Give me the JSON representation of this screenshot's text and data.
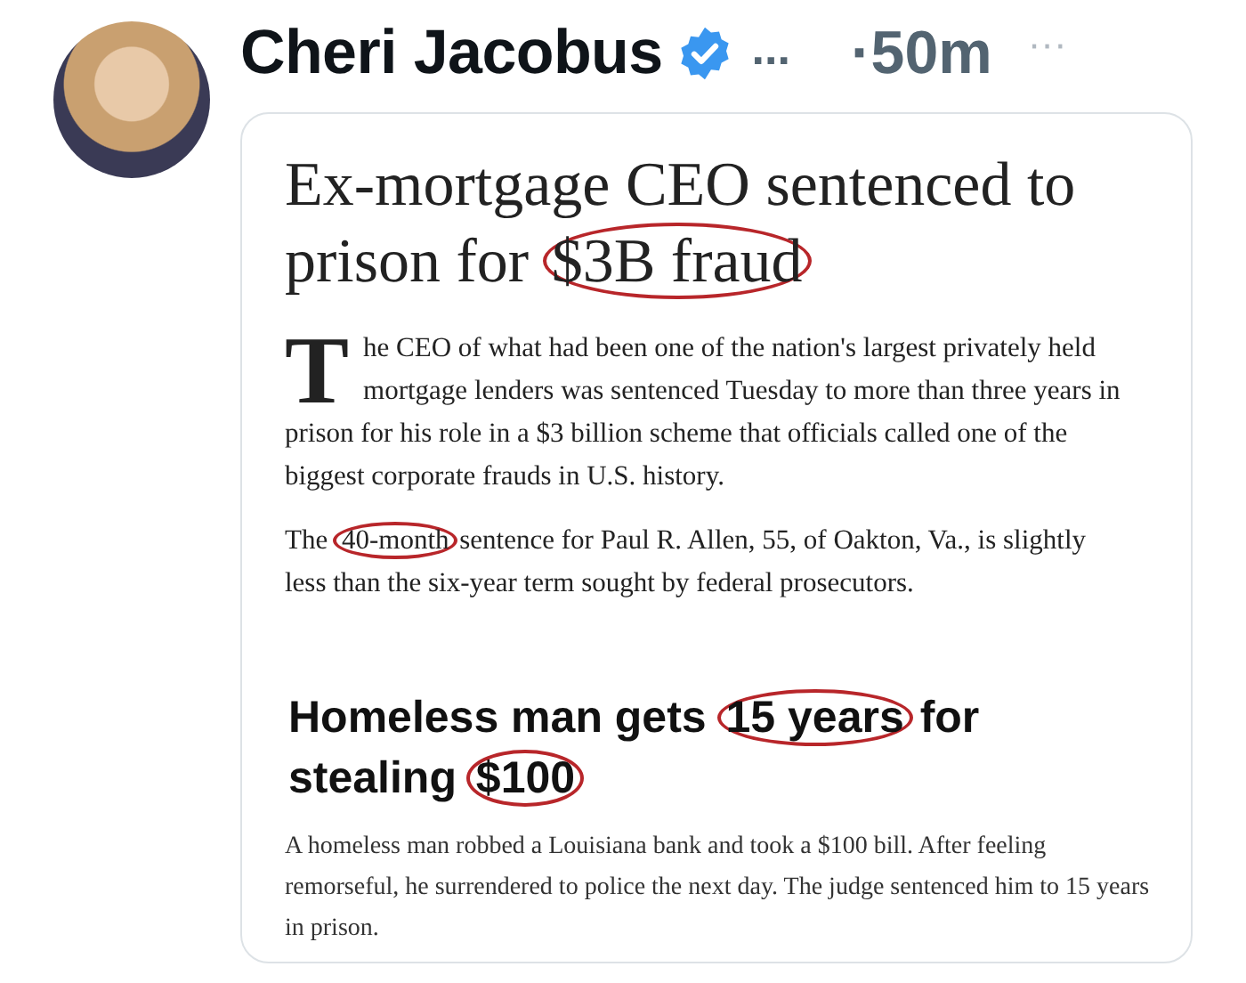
{
  "tweet": {
    "author": "Cheri Jacobus",
    "verified": true,
    "truncation": "...",
    "time": "·50m",
    "more": "···"
  },
  "clipping": {
    "story_1": {
      "headline": [
        {
          "text": "Ex-mortgage CEO sentenced to prison for ",
          "circled": false
        },
        {
          "text": "$3B fraud",
          "circled": true
        }
      ],
      "drop_cap": "T",
      "lead": "he CEO of what had been one of the nation's largest privately held mortgage lenders was sentenced Tuesday to more than three years in prison for his role in a $3 billion scheme that officials called one of the biggest corporate frauds in U.S. history.",
      "paragraph": [
        {
          "text": "The ",
          "circled": false
        },
        {
          "text": "40-month",
          "circled": true
        },
        {
          "text": " sentence for Paul R. Allen, 55, of Oakton, Va., is slightly less than the six-year term sought by federal prosecutors.",
          "circled": false
        }
      ]
    },
    "story_2": {
      "headline": [
        {
          "text": "Homeless man gets ",
          "circled": false
        },
        {
          "text": "15 years",
          "circled": true
        },
        {
          "text": " for stealing ",
          "circled": false
        },
        {
          "text": "$100",
          "circled": true
        }
      ],
      "body": "A homeless man robbed a Louisiana bank and took a $100 bill. After feeling remorseful, he surrendered to police the next day. The judge sentenced him to 15 years in prison."
    }
  }
}
